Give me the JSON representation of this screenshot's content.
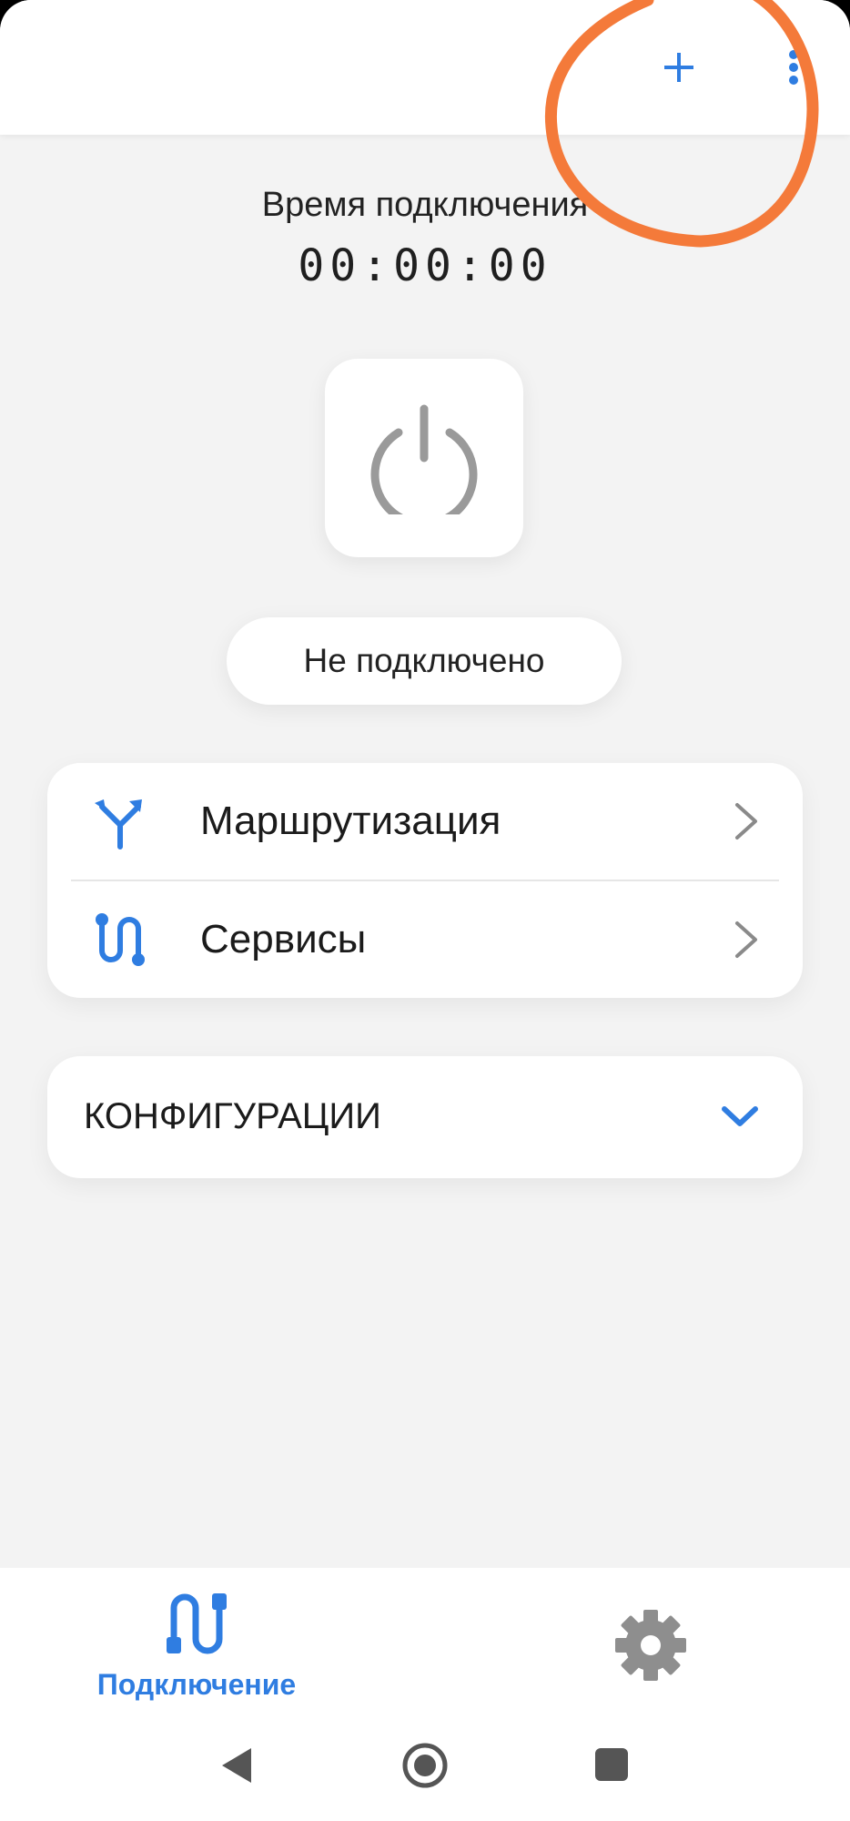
{
  "toolbar": {
    "add_icon": "plus-icon",
    "more_icon": "more-vert-icon",
    "accent_color": "#2f7de1"
  },
  "connection": {
    "time_label": "Время подключения",
    "time_value": "00:00:00",
    "status": "Не подключено",
    "power_icon": "power-icon"
  },
  "menu": {
    "items": [
      {
        "label": "Маршрутизация",
        "icon": "routing-icon"
      },
      {
        "label": "Сервисы",
        "icon": "services-icon"
      }
    ]
  },
  "configurations": {
    "label": "КОНФИГУРАЦИИ",
    "expanded": false
  },
  "bottom_nav": {
    "items": [
      {
        "label": "Подключение",
        "icon": "connection-icon",
        "active": true
      },
      {
        "icon": "gear-icon",
        "active": false
      }
    ]
  },
  "annotation": {
    "color": "#f47a3a"
  }
}
